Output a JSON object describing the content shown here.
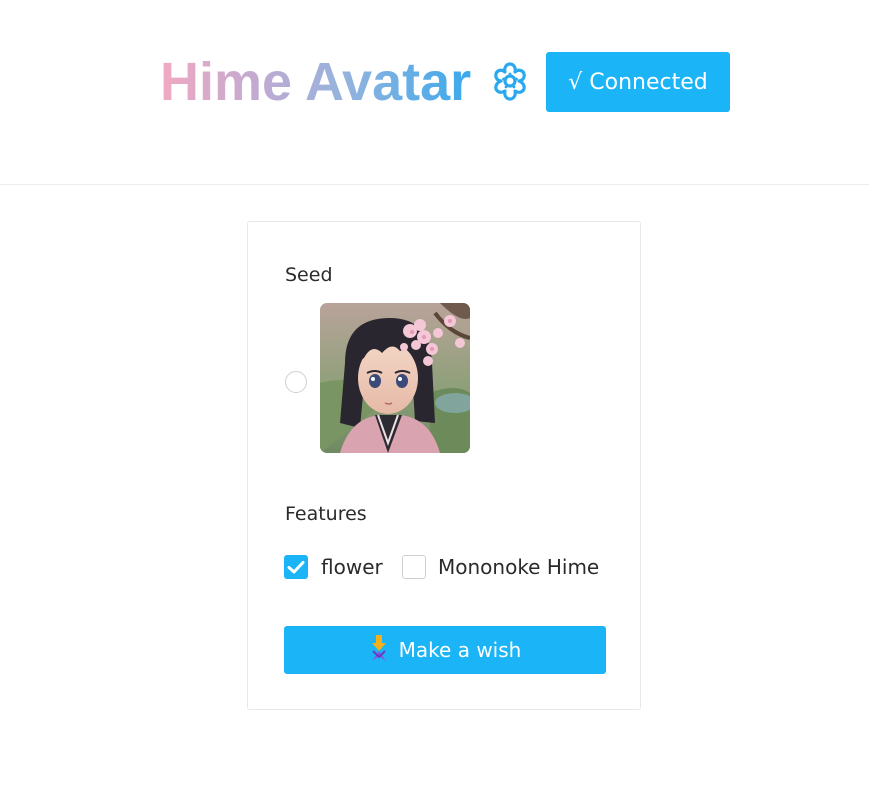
{
  "header": {
    "title": "Hime Avatar",
    "title_icon": "cherry-blossom-icon",
    "connection_button": {
      "label": "√ Connected",
      "color": "#1ab4f7"
    }
  },
  "form": {
    "seed": {
      "label": "Seed",
      "options": [
        {
          "image": "anime-girl-cherry-blossom-avatar",
          "selected": false
        }
      ]
    },
    "features": {
      "label": "Features",
      "options": [
        {
          "label": "flower",
          "checked": true
        },
        {
          "label": "Mononoke Hime",
          "checked": false
        }
      ]
    },
    "submit": {
      "label": "Make a wish",
      "icon": "wish-ribbon-icon"
    }
  },
  "colors": {
    "accent": "#1ab4f7",
    "title_gradient_start": "#f2a9c2",
    "title_gradient_end": "#3aa9ec"
  }
}
